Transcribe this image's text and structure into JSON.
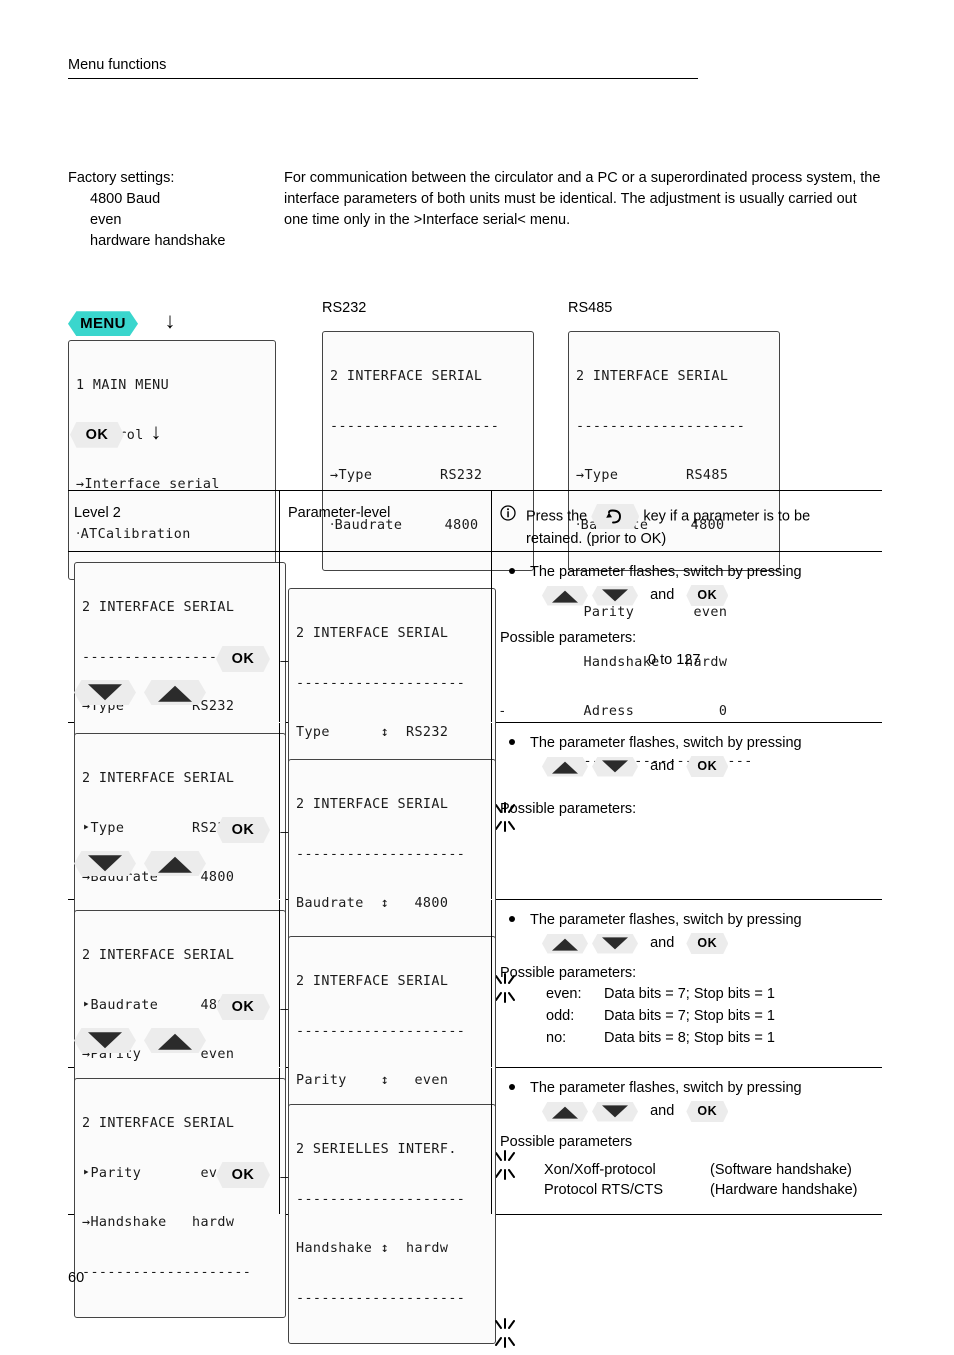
{
  "header": {
    "title": "Menu functions"
  },
  "intro": {
    "left_title": "Factory settings:",
    "left_items": [
      "4800 Baud",
      "even",
      "hardware handshake"
    ],
    "right_paragraph": "For communication between the circulator and a PC or a superordinated process system, the interface parameters of both units must be identical. The adjustment is usually carried out one time only in the >Interface serial< menu."
  },
  "nav": {
    "menu_key": "MENU",
    "ok_key": "OK",
    "down_arrow_glyph": "↓",
    "right_arrow_glyph": "→"
  },
  "main_menu_display": {
    "lines": [
      "1 MAIN MENU",
      "‣Control",
      "→Interface serial",
      "‧ATCalibration"
    ],
    "title": "1 MAIN MENU",
    "item_up": "Control",
    "item_sel": "Interface serial",
    "item_down": "ATCalibration"
  },
  "panels": [
    {
      "label": "RS232",
      "boxed_lines": [
        "2 INTERFACE SERIAL",
        "--------------------",
        "→Type        RS232",
        "‧Baudrate     4800"
      ],
      "tail_lines": [
        " Parity       even",
        " Handshake   hardw",
        " --------------------"
      ],
      "title": "2 INTERFACE SERIAL",
      "rows": [
        {
          "name": "Type",
          "value": "RS232"
        },
        {
          "name": "Baudrate",
          "value": "4800"
        },
        {
          "name": "Parity",
          "value": "even"
        },
        {
          "name": "Handshake",
          "value": "hardw"
        }
      ]
    },
    {
      "label": "RS485",
      "boxed_lines": [
        "2 INTERFACE SERIAL",
        "--------------------",
        "→Type        RS485",
        "‧Baudrate     4800"
      ],
      "tail_lines": [
        " Parity       even",
        " Handshake   hardw",
        " Adress          0",
        " --------------------"
      ],
      "title": "2 INTERFACE SERIAL",
      "rows": [
        {
          "name": "Type",
          "value": "RS485"
        },
        {
          "name": "Baudrate",
          "value": "4800"
        },
        {
          "name": "Parity",
          "value": "even"
        },
        {
          "name": "Handshake",
          "value": "hardw"
        },
        {
          "name": "Adress",
          "value": "0"
        }
      ]
    }
  ],
  "table": {
    "head": {
      "col_a": "Level 2",
      "col_b": "Parameter-level",
      "note_pre": "Press the",
      "note_post": "key if a parameter is to be",
      "note_line2": "retained. (prior to OK)"
    },
    "rows": [
      {
        "level_lines": [
          "2 INTERFACE SERIAL",
          "--------------------",
          "→Type        RS232",
          "‧Baudrate     4800"
        ],
        "param_lines": [
          "2 INTERFACE SERIAL",
          "--------------------",
          "Type      ↕  RS232",
          "--------------------"
        ],
        "bullet": "The parameter flashes, switch by pressing",
        "and_label": "and",
        "possible_label": "Possible parameters:",
        "possible_value": "0 to 127"
      },
      {
        "level_lines": [
          "2 INTERFACE SERIAL",
          "‣Type        RS232",
          "→Baudrate     4800",
          "‧Parity       even"
        ],
        "param_lines": [
          "2 INTERFACE SERIAL",
          "--------------------",
          "Baudrate  ↕   4800",
          "--------------------"
        ],
        "bullet": "The parameter flashes, switch by pressing",
        "and_label": "and",
        "possible_label": "Possible parameters:",
        "possible_value": ""
      },
      {
        "level_lines": [
          "2 INTERFACE SERIAL",
          "‣Baudrate     4800",
          "→Parity       even",
          "‧Handshake   hardw"
        ],
        "param_lines": [
          "2 INTERFACE SERIAL",
          "--------------------",
          "Parity    ↕   even",
          "--------------------"
        ],
        "bullet": "The parameter flashes, switch by pressing",
        "and_label": "and",
        "possible_label": "Possible parameters:",
        "param_table": [
          {
            "key": "even:",
            "desc": "Data bits = 7; Stop bits = 1"
          },
          {
            "key": "odd:",
            "desc": "Data bits = 7; Stop bits = 1"
          },
          {
            "key": "no:",
            "desc": "Data bits = 8; Stop bits = 1"
          }
        ]
      },
      {
        "level_lines": [
          "2 INTERFACE SERIAL",
          "‣Parity       even",
          "→Handshake   hardw",
          "--------------------"
        ],
        "param_lines": [
          "2 SERIELLES INTERF.",
          "--------------------",
          "Handshake ↕  hardw",
          "--------------------"
        ],
        "bullet": "The parameter flashes, switch by pressing",
        "and_label": "and",
        "possible_label": "Possible parameters",
        "protocols": [
          {
            "name": "Xon/Xoff-protocol",
            "desc": "(Software handshake)"
          },
          {
            "name": "Protocol RTS/CTS",
            "desc": "(Hardware handshake)"
          }
        ]
      }
    ]
  },
  "footer": {
    "page_number": "60"
  },
  "colors": {
    "menu_key": "#3ad6cd",
    "key_gray": "#ececec",
    "lcd_bg": "#fbfbfb"
  }
}
